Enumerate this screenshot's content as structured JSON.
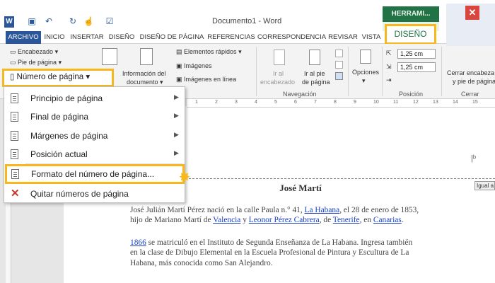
{
  "window": {
    "title": "Documento1 - Word"
  },
  "contextual": {
    "header": "HERRAMI...",
    "tab": "DISEÑO"
  },
  "tabs": [
    "ARCHIVO",
    "INICIO",
    "INSERTAR",
    "DISEÑO",
    "DISEÑO DE PÁGINA",
    "REFERENCIAS",
    "CORRESPONDENCIA",
    "REVISAR",
    "VISTA"
  ],
  "ribbon": {
    "encabezado": "Encabezado",
    "pie_de_pagina": "Pie de página",
    "numero_pagina": "Número de página",
    "info_documento_1": "Información del",
    "info_documento_2": "documento",
    "elementos_rapidos": "Elementos rápidos",
    "imagenes": "Imágenes",
    "imagenes_en_linea": "Imágenes en línea",
    "ir_encabezado_1": "Ir al",
    "ir_encabezado_2": "encabezado",
    "ir_pie_1": "Ir al pie",
    "ir_pie_2": "de página",
    "navegacion": "Navegación",
    "opciones": "Opciones",
    "spin_top": "1,25 cm",
    "spin_bottom": "1,25 cm",
    "posicion": "Posición",
    "cerrar_1": "Cerrar encabeza",
    "cerrar_2": "y pie de página",
    "cerrar_group": "Cerrar"
  },
  "ruler": {
    "ticks": [
      "1",
      "2",
      "3",
      "4",
      "5",
      "6",
      "7",
      "8",
      "9",
      "10",
      "11",
      "12",
      "13",
      "14",
      "15"
    ]
  },
  "menu": {
    "items": [
      {
        "label": "Principio de página",
        "has_submenu": true
      },
      {
        "label": "Final de página",
        "has_submenu": true
      },
      {
        "label": "Márgenes de página",
        "has_submenu": true
      },
      {
        "label": "Posición actual",
        "has_submenu": true
      },
      {
        "label": "Formato del número de página...",
        "has_submenu": false
      },
      {
        "label": "Quitar números de página",
        "has_submenu": false
      }
    ]
  },
  "document": {
    "footer_tag": "Igual a",
    "heading": "José Martí",
    "para1_line1_a": "José Julián Martí Pérez nació en la calle Paula n.° 41, ",
    "para1_link1": "La Habana",
    "para1_line1_b": ", el 28 de enero de 1853,",
    "para1_line2_a": "hijo de Mariano Martí de ",
    "para1_link2": "Valencia",
    "para1_line2_b": " y ",
    "para1_link3": "Leonor Pérez Cabrera",
    "para1_line2_c": ", de ",
    "para1_link4": "Tenerife",
    "para1_line2_d": ", en ",
    "para1_link5": "Canarias",
    "para1_line2_e": ".",
    "para2_link": "1866",
    "para2_line1": " se matriculó en el Instituto de Segunda Enseñanza de La Habana. Ingresa también",
    "para2_line2": "en la clase de Dibujo Elemental en la Escuela Profesional de Pintura y Escultura de La",
    "para2_line3": "Habana, más conocida como San Alejandro."
  },
  "colors": {
    "word_blue": "#2b579a",
    "context_green": "#217346",
    "highlight": "#f7b81e",
    "link": "#1a40c0"
  }
}
